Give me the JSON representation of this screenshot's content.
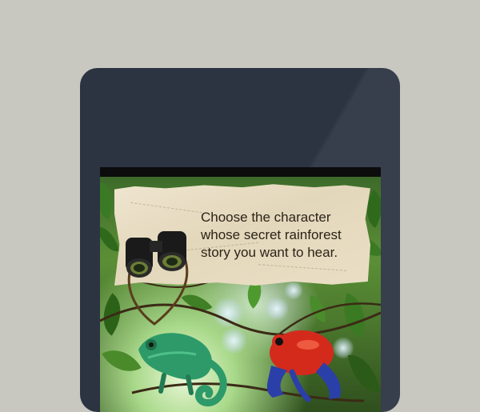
{
  "app": {
    "prompt_text": "Choose the character whose secret rainforest story you want to hear."
  },
  "characters": [
    {
      "name": "chameleon"
    },
    {
      "name": "poison-dart-frog"
    }
  ],
  "colors": {
    "background": "#c8c8c0",
    "device_frame": "#2c3442",
    "map_paper": "#e8ddc3",
    "prompt_text": "#2b2418",
    "frog_red": "#d42a1c",
    "frog_blue": "#2b3fa8",
    "chameleon_green": "#2e9a6a"
  },
  "icons": [
    "binoculars-icon",
    "chameleon-icon",
    "frog-icon"
  ]
}
